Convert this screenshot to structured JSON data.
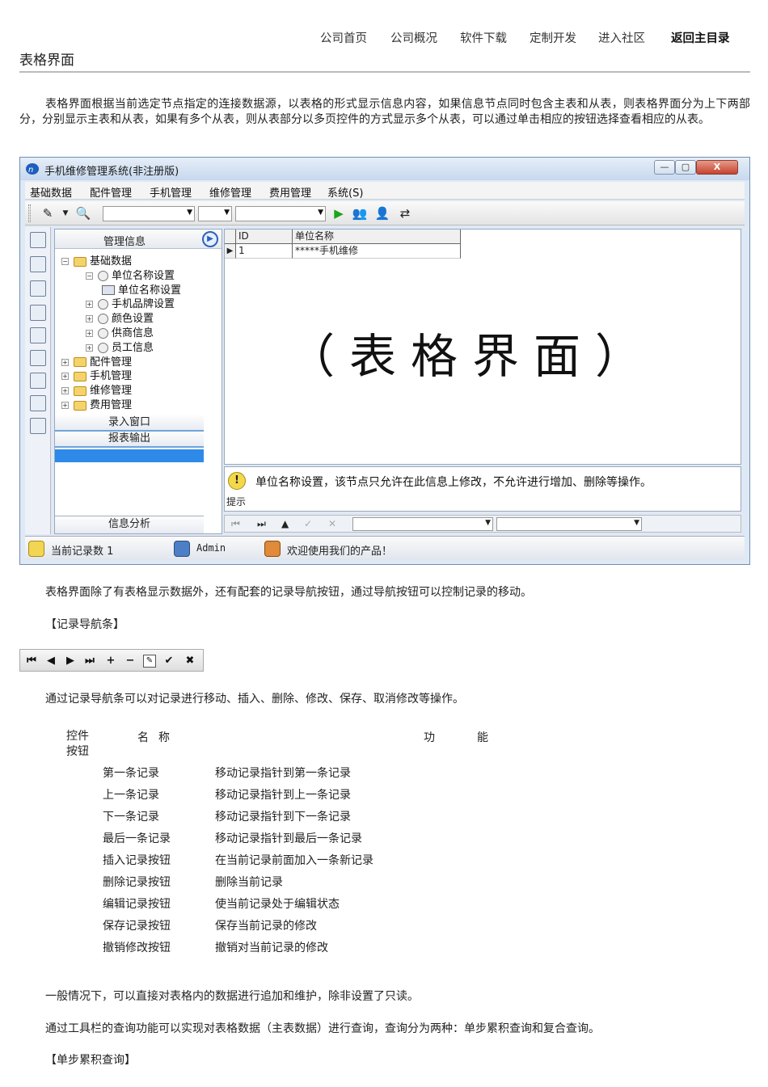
{
  "nav": {
    "home": "公司首页",
    "overview": "公司概况",
    "download": "软件下载",
    "custom": "定制开发",
    "community": "进入社区",
    "back": "返回主目录"
  },
  "page_title": "表格界面",
  "intro": "表格界面根据当前选定节点指定的连接数据源，以表格的形式显示信息内容，如果信息节点同时包含主表和从表，则表格界面分为上下两部分，分别显示主表和从表，如果有多个从表，则从表部分以多页控件的方式显示多个从表，可以通过单击相应的按钮选择查看相应的从表。",
  "app": {
    "title": "手机维修管理系统(非注册版)",
    "menus": [
      "基础数据",
      "配件管理",
      "手机管理",
      "维修管理",
      "费用管理",
      "系统(S)"
    ],
    "panel_title": "管理信息",
    "tree": [
      {
        "label": "基础数据",
        "level": 0,
        "expander": "⊟",
        "icon": "folder"
      },
      {
        "label": "单位名称设置",
        "level": 1,
        "expander": "⊟",
        "icon": "gear"
      },
      {
        "label": "单位名称设置",
        "level": 2,
        "expander": "",
        "icon": "grid"
      },
      {
        "label": "手机品牌设置",
        "level": 1,
        "expander": "⊞",
        "icon": "gear"
      },
      {
        "label": "颜色设置",
        "level": 1,
        "expander": "⊞",
        "icon": "gear"
      },
      {
        "label": "供商信息",
        "level": 1,
        "expander": "⊞",
        "icon": "gear"
      },
      {
        "label": "员工信息",
        "level": 1,
        "expander": "⊞",
        "icon": "gear"
      },
      {
        "label": "配件管理",
        "level": 0,
        "expander": "⊞",
        "icon": "folder"
      },
      {
        "label": "手机管理",
        "level": 0,
        "expander": "⊞",
        "icon": "folder"
      },
      {
        "label": "维修管理",
        "level": 0,
        "expander": "⊞",
        "icon": "folder"
      },
      {
        "label": "费用管理",
        "level": 0,
        "expander": "⊞",
        "icon": "folder"
      }
    ],
    "tab_entry": "录入窗口",
    "tab_report": "报表输出",
    "tab_analysis": "信息分析",
    "grid": {
      "col_id": "ID",
      "col_name": "单位名称",
      "row_id": "1",
      "row_name": "*****手机维修"
    },
    "watermark": "（表格界面）",
    "tip_label": "提示",
    "tip_text": "单位名称设置，该节点只允许在此信息上修改，不允许进行增加、删除等操作。",
    "status_count": "当前记录数 1",
    "status_user": "Admin",
    "status_welcome": "欢迎使用我们的产品！"
  },
  "para2": "表格界面除了有表格显示数据外，还有配套的记录导航按钮，通过导航按钮可以控制记录的移动。",
  "section_nav": "【记录导航条】",
  "recnav_glyphs": [
    "⏮",
    "◀",
    "▶",
    "⏭",
    "+",
    "−",
    "✎",
    "✔",
    "✖"
  ],
  "para3": "通过记录导航条可以对记录进行移动、插入、删除、修改、保存、取消修改等操作。",
  "table_head": {
    "c1": "控件按钮",
    "c2": "名称",
    "c3": "功能"
  },
  "table_rows": [
    {
      "name": "第一条记录",
      "func": "移动记录指针到第一条记录"
    },
    {
      "name": "上一条记录",
      "func": "移动记录指针到上一条记录"
    },
    {
      "name": "下一条记录",
      "func": "移动记录指针到下一条记录"
    },
    {
      "name": "最后一条记录",
      "func": "移动记录指针到最后一条记录"
    },
    {
      "name": "插入记录按钮",
      "func": "在当前记录前面加入一条新记录"
    },
    {
      "name": "删除记录按钮",
      "func": "删除当前记录"
    },
    {
      "name": "编辑记录按钮",
      "func": "使当前记录处于编辑状态"
    },
    {
      "name": "保存记录按钮",
      "func": "保存当前记录的修改"
    },
    {
      "name": "撤销修改按钮",
      "func": "撤销对当前记录的修改"
    }
  ],
  "para4": "一般情况下，可以直接对表格内的数据进行追加和维护，除非设置了只读。",
  "para5": "通过工具栏的查询功能可以实现对表格数据（主表数据）进行查询，查询分为两种：单步累积查询和复合查询。",
  "section_query": "【单步累积查询】"
}
